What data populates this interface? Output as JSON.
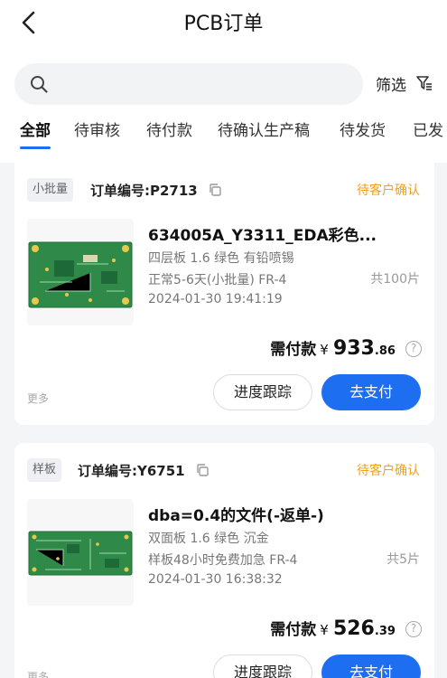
{
  "header": {
    "title": "PCB订单"
  },
  "search": {
    "placeholder": "",
    "filter_label": "筛选"
  },
  "tabs": [
    "全部",
    "待审核",
    "待付款",
    "待确认生产稿",
    "待发货",
    "已发"
  ],
  "orders": [
    {
      "badge": "小批量",
      "order_no": "订单编号:P2713",
      "status": "待客户确认",
      "name": "634005A_Y3311_EDA彩色...",
      "spec1": "四层板 1.6 绿色 有铅喷锡",
      "spec2": "正常5-6天(小批量) FR-4",
      "date": "2024-01-30 19:41:19",
      "qty": "共100片",
      "pay_label": "需付款",
      "currency": "¥",
      "amount_int": "933",
      "amount_dec": ".86",
      "more": "更多",
      "track_label": "进度跟踪",
      "pay_button": "去支付"
    },
    {
      "badge": "样板",
      "order_no": "订单编号:Y6751",
      "status": "待客户确认",
      "name": "dba=0.4的文件(-返单-)",
      "spec1": "双面板 1.6 绿色 沉金",
      "spec2": "样板48小时免费加急 FR-4",
      "date": "2024-01-30 16:38:32",
      "qty": "共5片",
      "pay_label": "需付款",
      "currency": "¥",
      "amount_int": "526",
      "amount_dec": ".39",
      "more": "更多",
      "track_label": "进度跟踪",
      "pay_button": "去支付"
    }
  ],
  "colors": {
    "accent": "#1e6ef2",
    "status": "#f0a020",
    "pcb_green": "#2f8a4a"
  },
  "icons": [
    "back-arrow-icon",
    "search-icon",
    "filter-icon",
    "copy-icon",
    "help-icon"
  ]
}
